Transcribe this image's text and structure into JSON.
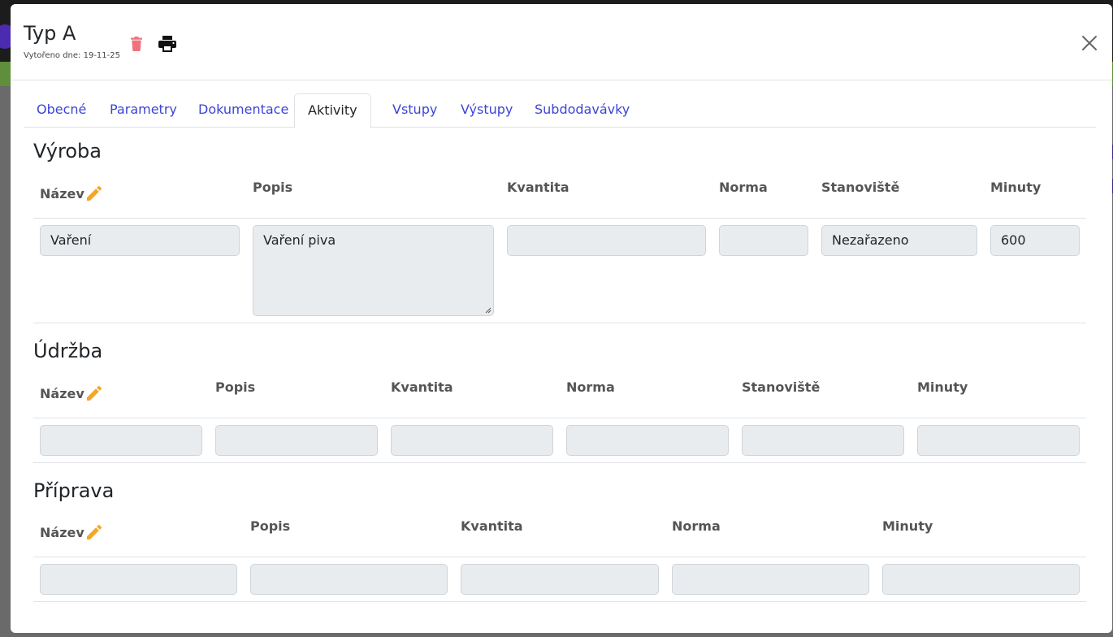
{
  "modal": {
    "title": "Typ A",
    "created": "Vytořeno dne: 19-11-25"
  },
  "tabs": [
    {
      "label": "Obecné"
    },
    {
      "label": "Parametry"
    },
    {
      "label": "Dokumentace"
    },
    {
      "label": "Aktivity",
      "active": true
    },
    {
      "label": "Vstupy"
    },
    {
      "label": "Výstupy"
    },
    {
      "label": "Subdodavávky"
    }
  ],
  "sections": {
    "vyroba": {
      "title": "Výroba",
      "headers": [
        "Název",
        "Popis",
        "Kvantita",
        "Norma",
        "Stanoviště",
        "Minuty"
      ],
      "values": {
        "nazev": "Vaření",
        "popis": "Vaření piva",
        "kvantita": "",
        "norma": "",
        "stanoviste": "Nezařazeno",
        "minuty": "600"
      }
    },
    "udrzba": {
      "title": "Údržba",
      "headers": [
        "Název",
        "Popis",
        "Kvantita",
        "Norma",
        "Stanoviště",
        "Minuty"
      ],
      "values": {
        "nazev": "",
        "popis": "",
        "kvantita": "",
        "norma": "",
        "stanoviste": "",
        "minuty": ""
      }
    },
    "priprava": {
      "title": "Příprava",
      "headers": [
        "Název",
        "Popis",
        "Kvantita",
        "Norma",
        "Minuty"
      ],
      "values": {
        "nazev": "",
        "popis": "",
        "kvantita": "",
        "norma": "",
        "minuty": ""
      }
    }
  },
  "icons": {
    "delete": "trash-icon",
    "print": "printer-icon",
    "close": "close-icon",
    "edit": "pencil-icon"
  },
  "colors": {
    "tab_link": "#3b45d6",
    "delete": "#f0727d",
    "pencil": "#f5a623",
    "field_bg": "#e9ecef"
  }
}
